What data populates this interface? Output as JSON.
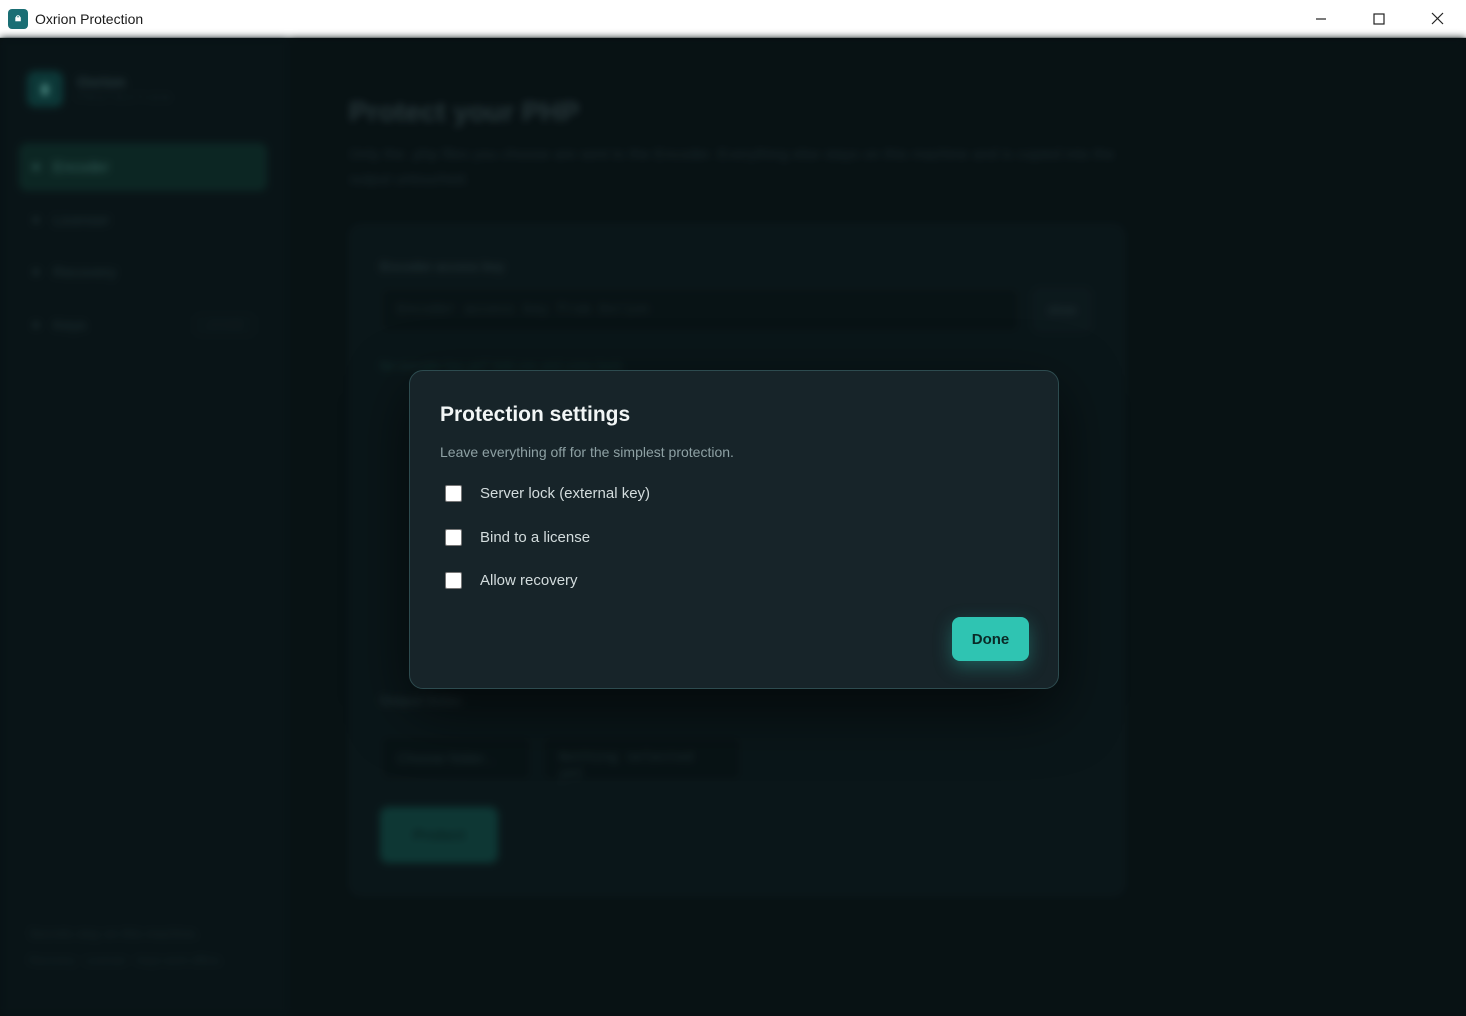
{
  "window": {
    "title": "Oxrion Protection",
    "app_icon": "lock-icon"
  },
  "sidebar": {
    "brand_name": "Oxrion",
    "brand_sub": "PROTECTION",
    "items": [
      {
        "label": "Encoder"
      },
      {
        "label": "Licenser"
      },
      {
        "label": "Recovery"
      },
      {
        "label": "Keys",
        "badge": "LOCKED"
      }
    ],
    "footer_line1": "Secrets stay on this machine.",
    "footer_line2": "Recovery · Licenser · Keys work offline."
  },
  "main": {
    "title": "Protect your PHP",
    "description": "Only the .php files you choose are sent to the Encoder. Everything else stays on this machine and is copied into the output untouched.",
    "access_key_label": "Encoder access key",
    "access_key_placeholder": "Encoder access key from Oxrion",
    "show_label": "show",
    "key_hint": "No encoder key yet? Add one and come back",
    "output_label": "Output folder",
    "choose_folder_label": "Choose folder...",
    "nothing_selected": "Nothing selected yet",
    "protect_label": "Protect"
  },
  "modal": {
    "title": "Protection settings",
    "subtitle": "Leave everything off for the simplest protection.",
    "options": [
      {
        "label": "Server lock (external key)",
        "checked": false
      },
      {
        "label": "Bind to a license",
        "checked": false
      },
      {
        "label": "Allow recovery",
        "checked": false
      }
    ],
    "done_label": "Done"
  },
  "colors": {
    "accent": "#2fc4b2",
    "modal_bg": "#172429",
    "app_bg": "#0b1518"
  }
}
